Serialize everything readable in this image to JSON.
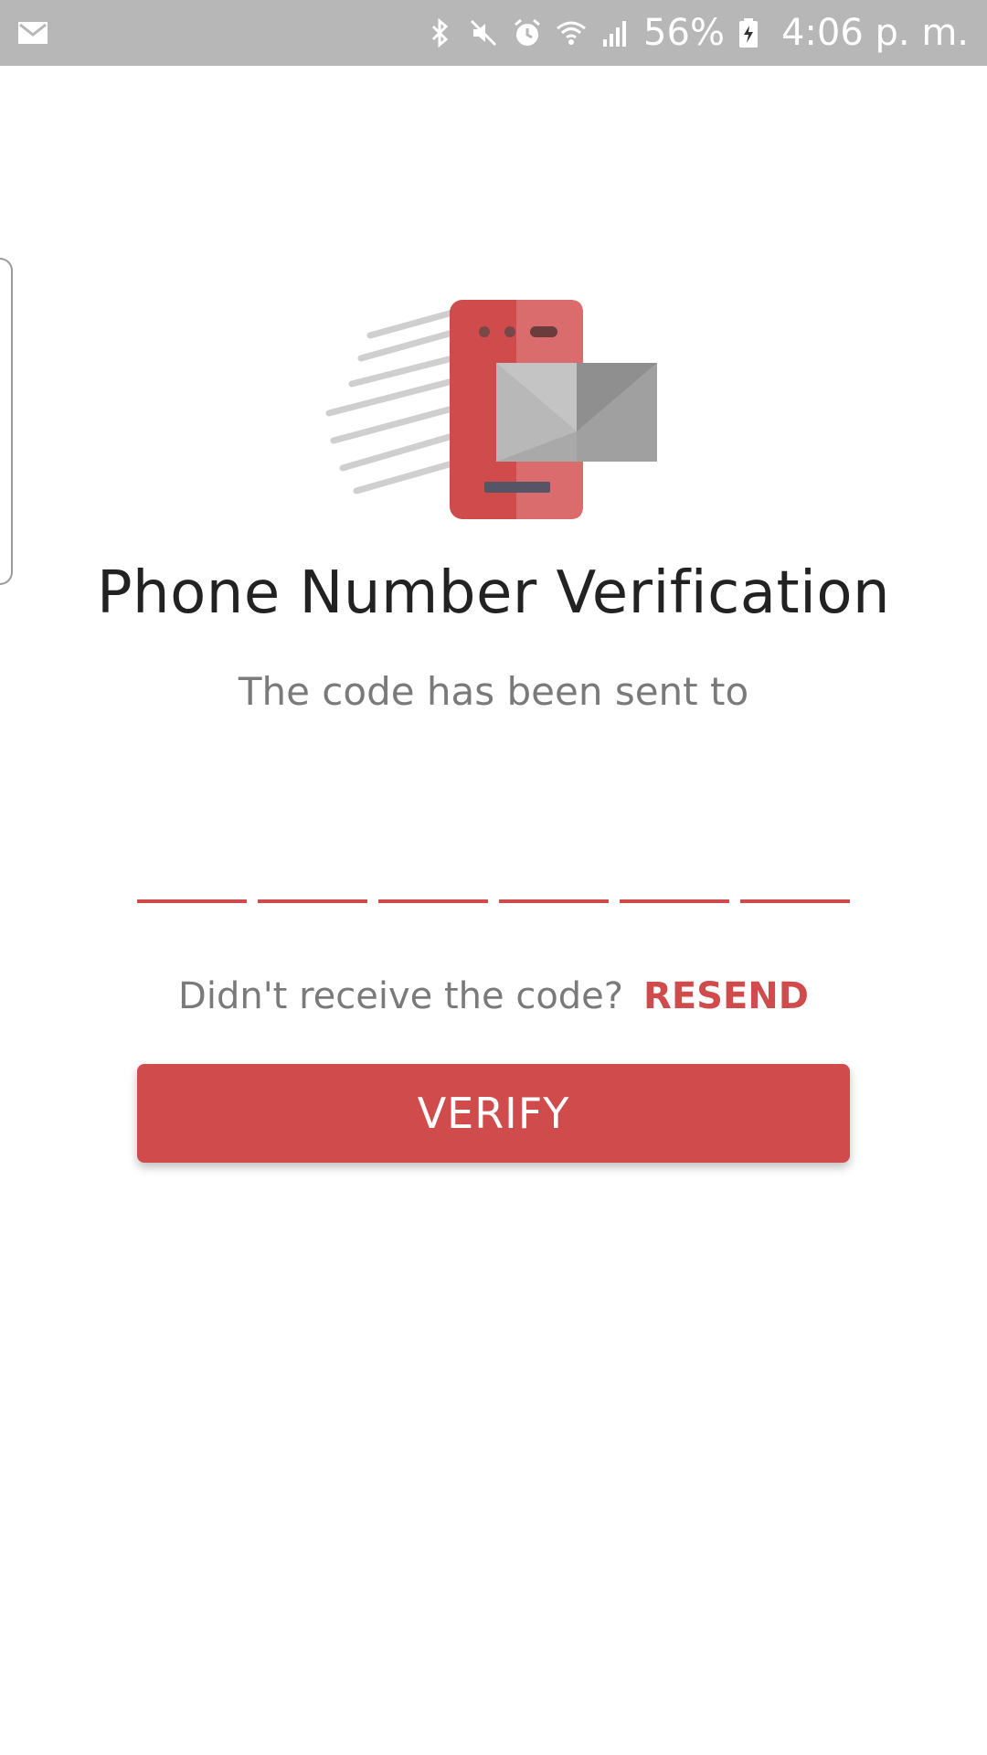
{
  "status_bar": {
    "notification_icon": "gmail-icon",
    "icons": [
      "bluetooth-icon",
      "mute-icon",
      "alarm-icon",
      "wifi-icon",
      "signal-icon"
    ],
    "battery_percent": "56%",
    "time": "4:06 p. m."
  },
  "header": {
    "title": "Phone Number Verification",
    "subtitle": "The code has been sent to"
  },
  "otp": {
    "length": 6,
    "values": [
      "",
      "",
      "",
      "",
      "",
      ""
    ]
  },
  "resend": {
    "prompt": "Didn't receive the code?",
    "link_label": "RESEND"
  },
  "actions": {
    "verify_label": "VERIFY"
  },
  "colors": {
    "accent": "#d04b4c",
    "status_bar": "#b7b7b7",
    "text_primary": "#222222",
    "text_secondary": "#7a7a7a"
  }
}
